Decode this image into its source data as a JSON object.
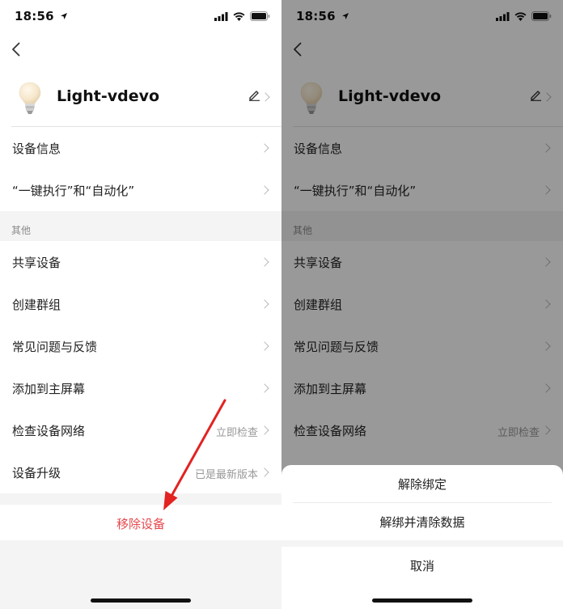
{
  "status_bar": {
    "time": "18:56"
  },
  "device": {
    "name": "Light-vdevo"
  },
  "menu_top": [
    {
      "label": "设备信息"
    },
    {
      "label": "“一键执行”和“自动化”"
    }
  ],
  "section_other": {
    "title": "其他"
  },
  "menu_other": [
    {
      "label": "共享设备",
      "value": ""
    },
    {
      "label": "创建群组",
      "value": ""
    },
    {
      "label": "常见问题与反馈",
      "value": ""
    },
    {
      "label": "添加到主屏幕",
      "value": ""
    },
    {
      "label": "检查设备网络",
      "value": "立即检查"
    },
    {
      "label": "设备升级",
      "value": "已是最新版本"
    }
  ],
  "remove_device": {
    "label": "移除设备"
  },
  "action_sheet": {
    "unbind": "解除绑定",
    "unbind_clear": "解绑并清除数据",
    "cancel": "取消"
  },
  "colors": {
    "danger": "#e5484d",
    "annotation_arrow": "#e32222",
    "section_bg": "#f4f4f4",
    "overlay": "rgba(0,0,0,0.40)"
  },
  "icons": [
    "location-arrow-icon",
    "cellular-signal-icon",
    "wifi-icon",
    "battery-icon",
    "back-chevron-icon",
    "lightbulb-icon",
    "pencil-edit-icon",
    "chevron-right-icon"
  ]
}
